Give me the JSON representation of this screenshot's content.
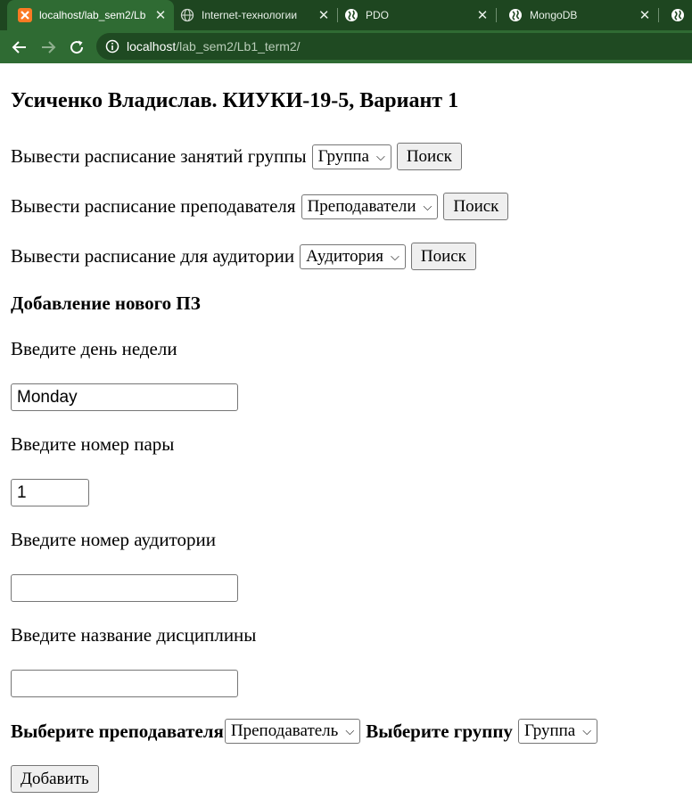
{
  "browser": {
    "tabs": [
      {
        "title": "localhost/lab_sem2/Lb",
        "icon": "xampp-icon",
        "active": true
      },
      {
        "title": "Internet-технологии",
        "icon": "globe-icon",
        "active": false
      },
      {
        "title": "PDO",
        "icon": "globe-icon",
        "active": false
      },
      {
        "title": "MongoDB",
        "icon": "globe-icon",
        "active": false
      },
      {
        "title": "",
        "icon": "globe-icon",
        "active": false
      }
    ],
    "url_host": "localhost",
    "url_path": "/lab_sem2/Lb1_term2/",
    "colors": {
      "tabbar": "#1e4620",
      "toolbar": "#2f6b33"
    }
  },
  "page": {
    "title": "Усиченко Владислав. КИУКИ-19-5, Вариант 1",
    "group_query": {
      "label": "Вывести расписание занятий группы",
      "select_value": "Группа",
      "button": "Поиск"
    },
    "teacher_query": {
      "label": "Вывести расписание преподавателя",
      "select_value": "Преподаватели",
      "button": "Поиск"
    },
    "room_query": {
      "label": "Вывести расписание для аудитории",
      "select_value": "Аудитория",
      "button": "Поиск"
    },
    "add_section": {
      "heading": "Добавление нового ПЗ",
      "day_label": "Введите день недели",
      "day_value": "Monday",
      "pair_label": "Введите номер пары",
      "pair_value": "1",
      "room_label": "Введите номер аудитории",
      "room_value": "",
      "discipline_label": "Введите название дисциплины",
      "discipline_value": "",
      "teacher_label": "Выберите преподавателя",
      "teacher_select": "Преподаватель",
      "group_label": "Выберите группу",
      "group_select": "Группа",
      "submit": "Добавить"
    }
  }
}
